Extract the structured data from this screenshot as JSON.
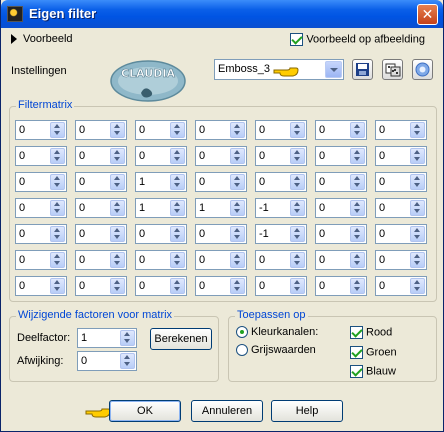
{
  "window": {
    "title": "Eigen filter",
    "close_symbol": "✕"
  },
  "preview": {
    "label": "Voorbeeld",
    "apply_label": "Voorbeeld op afbeelding",
    "apply_checked": true
  },
  "settings": {
    "label": "Instellingen",
    "preset": "Emboss_3",
    "logo_text": "CLAUDIA"
  },
  "matrix": {
    "title": "Filtermatrix",
    "values": [
      [
        "0",
        "0",
        "0",
        "0",
        "0",
        "0",
        "0"
      ],
      [
        "0",
        "0",
        "0",
        "0",
        "0",
        "0",
        "0"
      ],
      [
        "0",
        "0",
        "1",
        "0",
        "0",
        "0",
        "0"
      ],
      [
        "0",
        "0",
        "1",
        "1",
        "-1",
        "0",
        "0"
      ],
      [
        "0",
        "0",
        "0",
        "0",
        "-1",
        "0",
        "0"
      ],
      [
        "0",
        "0",
        "0",
        "0",
        "0",
        "0",
        "0"
      ],
      [
        "0",
        "0",
        "0",
        "0",
        "0",
        "0",
        "0"
      ]
    ]
  },
  "factors": {
    "title": "Wijzigende factoren voor matrix",
    "divisor_label": "Deelfactor:",
    "divisor_value": "1",
    "calculate_label": "Berekenen",
    "bias_label": "Afwijking:",
    "bias_value": "0"
  },
  "apply_to": {
    "title": "Toepassen op",
    "color_label": "Kleurkanalen:",
    "gray_label": "Grijswaarden",
    "selected": "color",
    "red_label": "Rood",
    "green_label": "Groen",
    "blue_label": "Blauw"
  },
  "buttons": {
    "ok": "OK",
    "cancel": "Annuleren",
    "help": "Help"
  },
  "colors": {
    "title_bar": "#0054e3",
    "group_title": "#0046d5",
    "check_mark": "#21a121",
    "pointer_hand": "#ffcc00"
  }
}
